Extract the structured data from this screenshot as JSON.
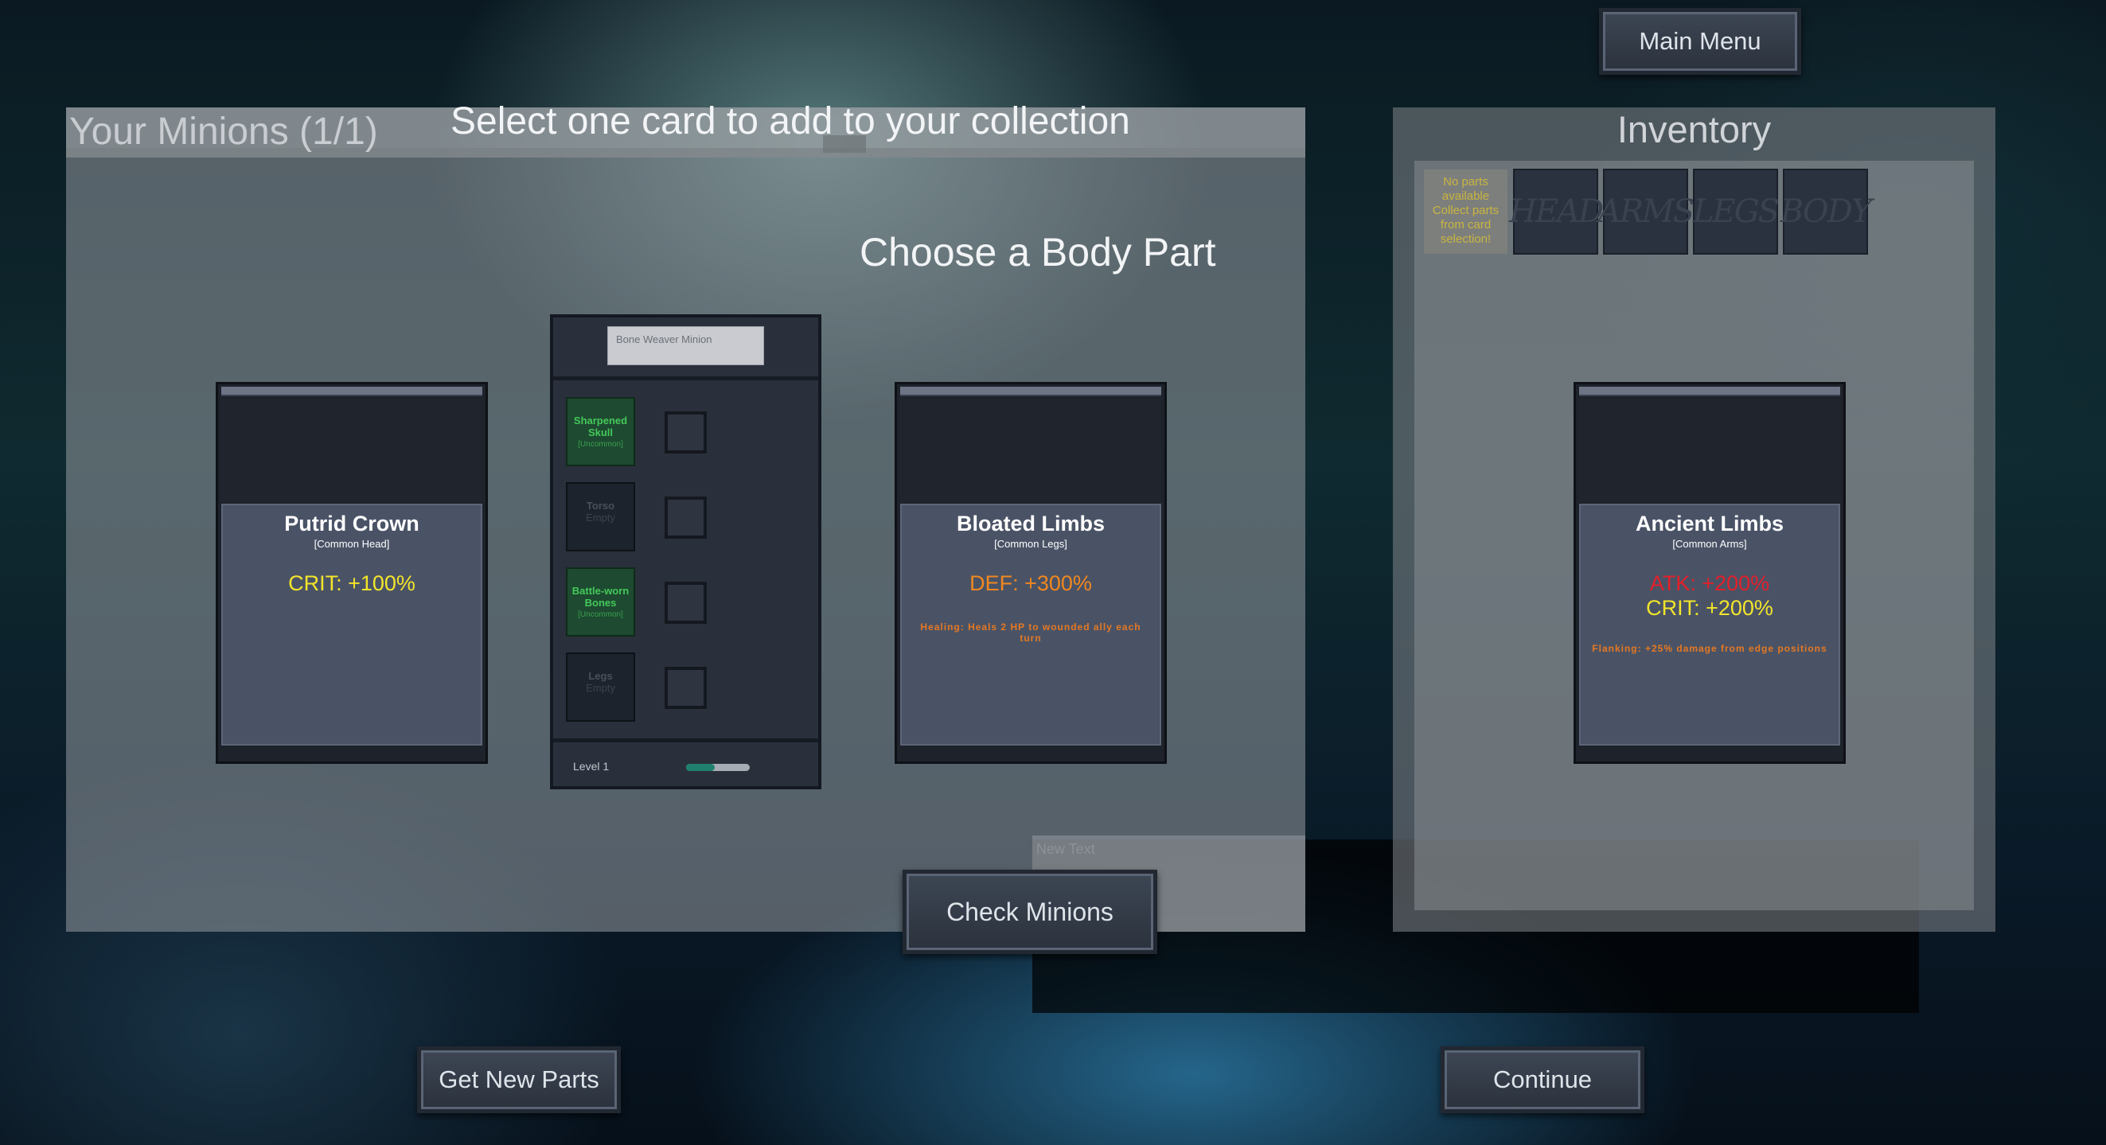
{
  "header": {
    "main_menu_label": "Main Menu"
  },
  "minions_panel": {
    "title": "Your Minions (1/1)",
    "select_prompt": "Select one card to add to your collection",
    "choose_prompt": "Choose a Body Part"
  },
  "cards": [
    {
      "name": "Putrid Crown",
      "rarity": "[Common Head]",
      "stats": [
        {
          "text": "CRIT: +100%",
          "color": "#f3e52a"
        }
      ],
      "ability": ""
    },
    {
      "name": "Bloated Limbs",
      "rarity": "[Common Legs]",
      "stats": [
        {
          "text": "DEF: +300%",
          "color": "#f0871f"
        }
      ],
      "ability": "Healing: Heals 2 HP to wounded ally each turn"
    },
    {
      "name": "Ancient Limbs",
      "rarity": "[Common Arms]",
      "stats": [
        {
          "text": "ATK: +200%",
          "color": "#e3202a"
        },
        {
          "text": "CRIT: +200%",
          "color": "#f3e52a"
        }
      ],
      "ability": "Flanking: +25% damage from edge positions"
    }
  ],
  "minion": {
    "name_placeholder": "Bone Weaver Minion",
    "parts": [
      {
        "name": "Sharpened Skull",
        "rarity": "[Uncommon]",
        "filled": true
      },
      {
        "name": "Torso",
        "rarity": "Empty",
        "filled": false
      },
      {
        "name": "Battle-worn Bones",
        "rarity": "[Uncommon]",
        "filled": true
      },
      {
        "name": "Legs",
        "rarity": "Empty",
        "filled": false
      }
    ],
    "level_label": "Level 1",
    "level_progress": 0.45
  },
  "inventory": {
    "title": "Inventory",
    "empty_message": "No parts available Collect parts from card selection!",
    "filters": [
      "HEAD",
      "ARMS",
      "LEGS",
      "BODY"
    ]
  },
  "misc": {
    "new_text": "New Text"
  },
  "buttons": {
    "check_minions": "Check Minions",
    "get_new_parts": "Get New Parts",
    "continue": "Continue"
  }
}
